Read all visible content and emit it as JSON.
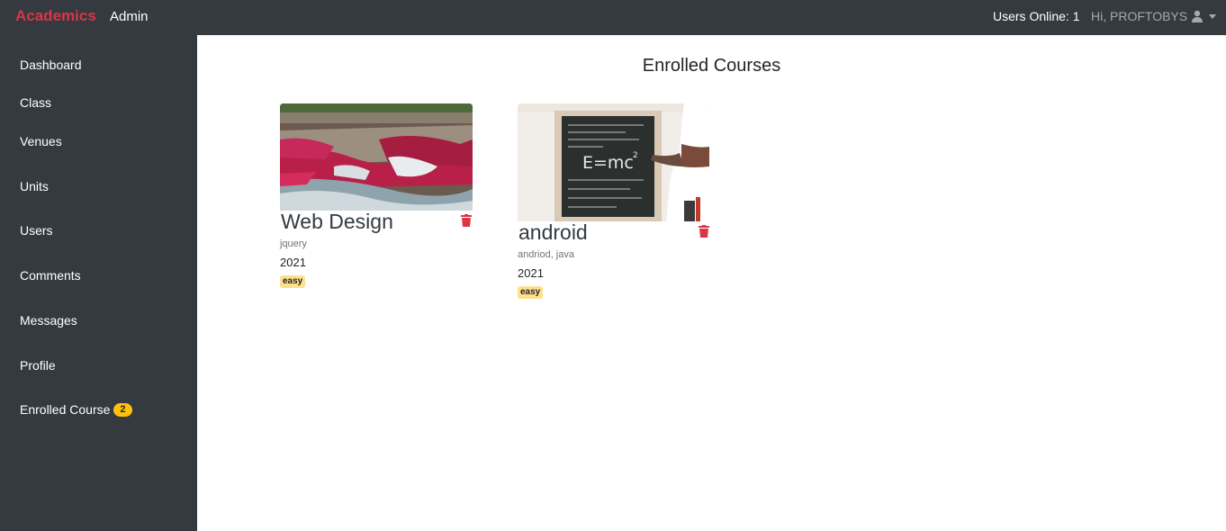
{
  "navbar": {
    "brand": "Academics",
    "admin": "Admin",
    "users_online": "Users Online: 1",
    "greeting": "Hi, PROFTOBYS",
    "user_icon": "user-icon",
    "caret_icon": "caret-down-icon"
  },
  "sidebar": {
    "items": [
      {
        "label": "Dashboard"
      },
      {
        "label": "Class"
      },
      {
        "label": "Venues"
      },
      {
        "label": "Units"
      },
      {
        "label": "Users"
      },
      {
        "label": "Comments"
      },
      {
        "label": "Messages"
      },
      {
        "label": "Profile"
      },
      {
        "label": "Enrolled Course",
        "badge": "2"
      }
    ]
  },
  "main": {
    "title": "Enrolled Courses",
    "courses": [
      {
        "name": "Web Design",
        "tags": "jquery",
        "year": "2021",
        "level": "easy",
        "image": "waterfall-river-photo"
      },
      {
        "name": "android",
        "tags": "andriod, java",
        "year": "2021",
        "level": "easy",
        "image": "blackboard-emc2-photo"
      }
    ]
  },
  "colors": {
    "navbar_bg": "#343a40",
    "brand": "#dc3545",
    "badge": "#ffc107",
    "trash": "#dc3545",
    "level_badge": "#ffe08a"
  }
}
